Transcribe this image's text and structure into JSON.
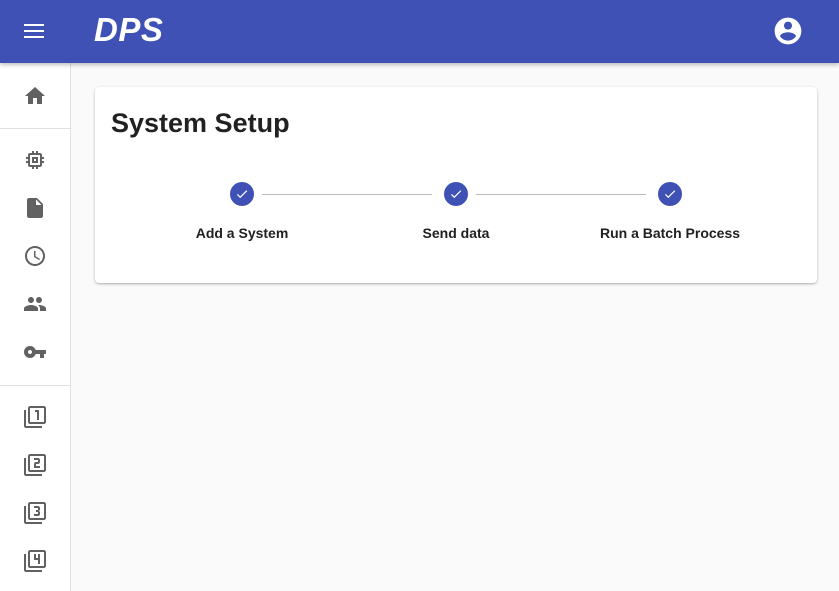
{
  "appbar": {
    "brand": "DPS",
    "menu_icon": "hamburger-menu-icon",
    "account_icon": "account-circle-icon",
    "color": "#3f51b5"
  },
  "sidebar": {
    "groups": [
      {
        "items": [
          {
            "icon": "home-icon"
          }
        ]
      },
      {
        "items": [
          {
            "icon": "chip-icon"
          },
          {
            "icon": "document-icon"
          },
          {
            "icon": "clock-icon"
          },
          {
            "icon": "people-icon"
          },
          {
            "icon": "key-icon"
          }
        ]
      },
      {
        "items": [
          {
            "icon": "filter-1-icon"
          },
          {
            "icon": "filter-2-icon"
          },
          {
            "icon": "filter-3-icon"
          },
          {
            "icon": "filter-4-icon"
          }
        ]
      }
    ]
  },
  "card": {
    "title": "System Setup",
    "steps": [
      {
        "label": "Add a System",
        "state": "completed"
      },
      {
        "label": "Send data",
        "state": "completed"
      },
      {
        "label": "Run a Batch Process",
        "state": "completed"
      }
    ]
  }
}
